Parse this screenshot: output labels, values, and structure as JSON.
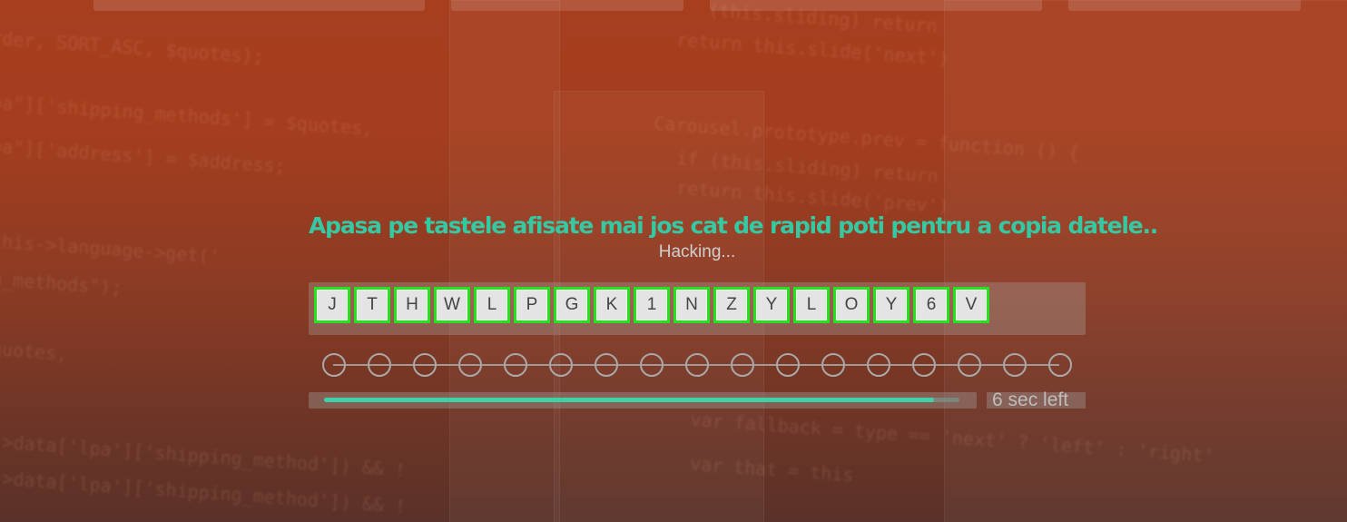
{
  "game": {
    "title": "Apasa pe tastele afisate mai jos cat de rapid poti pentru a copia datele..",
    "status": "Hacking...",
    "keys": [
      "J",
      "T",
      "H",
      "W",
      "L",
      "P",
      "G",
      "K",
      "1",
      "N",
      "Z",
      "Y",
      "L",
      "O",
      "Y",
      "6",
      "V"
    ],
    "completed_nodes": 0,
    "timer_label": "6 sec left",
    "time_progress": 0.96
  },
  "background": {
    "code_lines": [
      "rder, SORT_ASC, $quotes);",
      "pa\"]['shipping_methods'] = $quotes,",
      "pa\"]['address'] = $address;",
      "this->language->get('",
      "g_methods\");",
      "quotes,",
      "->data['lpa']['shipping_method']) && !",
      "->data['lpa']['shipping_method']) && !",
      "(this.sliding) return",
      "return this.slide('next')",
      "Carousel.prototype.prev = function () {",
      "if (this.sliding) return",
      "return this.slide('prev')",
      "var fallback = type == 'next' ? 'left' : 'right'",
      "var that = this"
    ]
  },
  "colors": {
    "accent": "#35c9a3",
    "key_border": "#26e21b",
    "background_top": "#a73f1f",
    "background_bottom": "#5a3128"
  }
}
